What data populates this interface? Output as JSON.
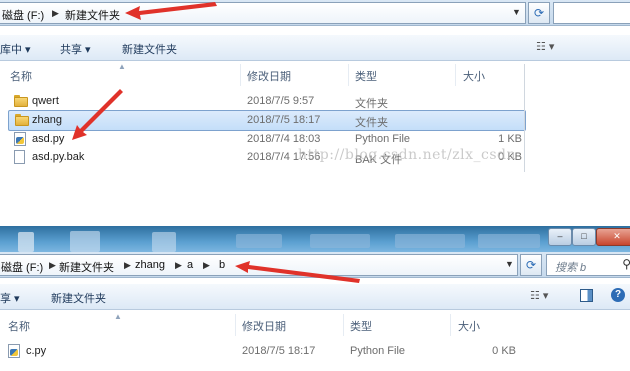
{
  "top": {
    "breadcrumb": [
      "磁盘 (F:)",
      "新建文件夹"
    ],
    "toolbar": {
      "library_label": "库中 ▾",
      "share_label": "共享 ▾",
      "new_folder_label": "新建文件夹"
    },
    "columns": {
      "name": "名称",
      "modified": "修改日期",
      "type": "类型",
      "size": "大小"
    },
    "rows": [
      {
        "name": "qwert",
        "modified": "2018/7/5 9:57",
        "type": "文件夹",
        "size": "",
        "icon": "folder-icon"
      },
      {
        "name": "zhang",
        "modified": "2018/7/5 18:17",
        "type": "文件夹",
        "size": "",
        "icon": "folder-icon"
      },
      {
        "name": "asd.py",
        "modified": "2018/7/4 18:03",
        "type": "Python File",
        "size": "1 KB",
        "icon": "python-file-icon"
      },
      {
        "name": "asd.py.bak",
        "modified": "2018/7/4 17:56",
        "type": "BAK 文件",
        "size": "0 KB",
        "icon": "file-icon"
      }
    ],
    "watermark": "http://blog.csdn.net/zlx_csdn"
  },
  "bottom": {
    "breadcrumb": [
      "磁盘 (F:)",
      "新建文件夹",
      "zhang",
      "a",
      "b"
    ],
    "search_placeholder": "搜索 b",
    "toolbar": {
      "share_label": "享 ▾",
      "new_folder_label": "新建文件夹"
    },
    "columns": {
      "name": "名称",
      "modified": "修改日期",
      "type": "类型",
      "size": "大小"
    },
    "rows": [
      {
        "name": "c.py",
        "modified": "2018/7/5 18:17",
        "type": "Python File",
        "size": "0 KB",
        "icon": "python-file-icon"
      }
    ]
  },
  "colors": {
    "arrow": "#e0322a",
    "selection": "#cce4fb",
    "toolbar_text": "#1e395b"
  }
}
